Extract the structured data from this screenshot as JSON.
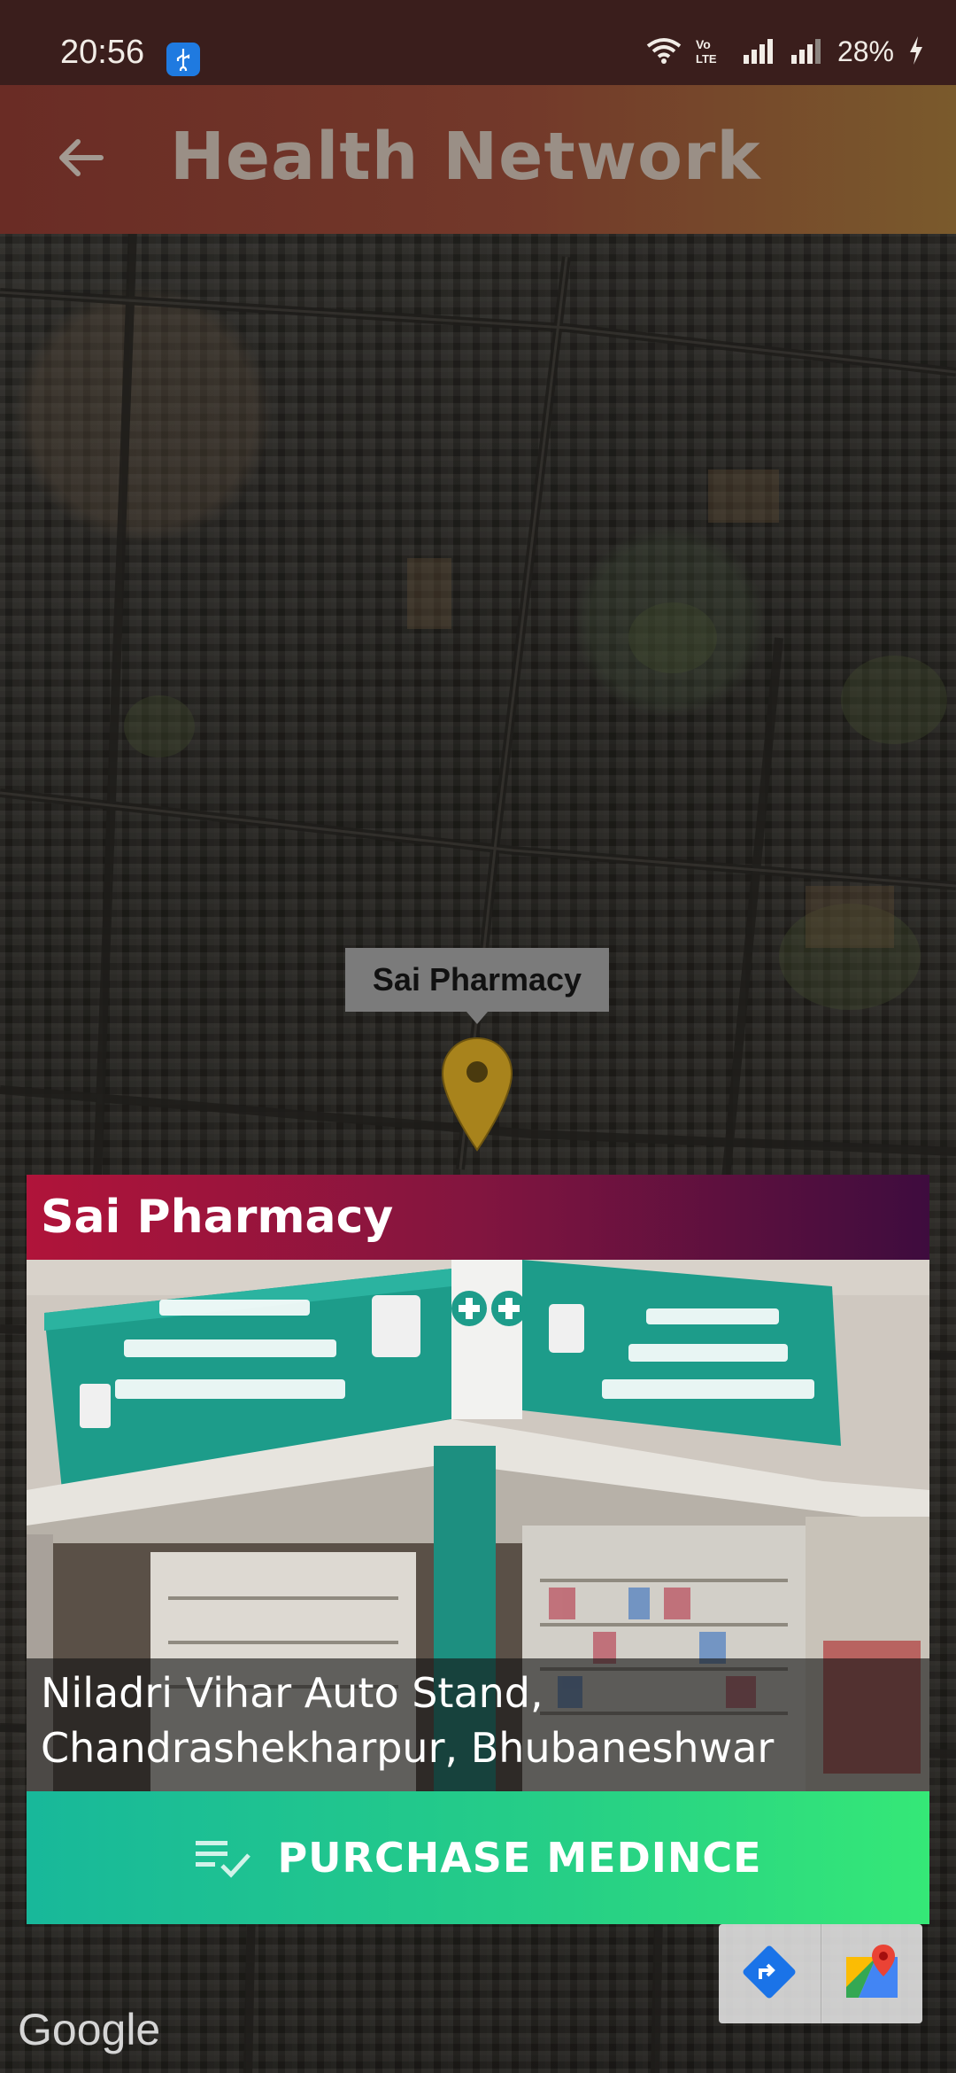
{
  "status_bar": {
    "time": "20:56",
    "network_label": "Vo LTE",
    "battery": "28%"
  },
  "app_bar": {
    "title": "Health Network",
    "back_icon": "arrow-left-icon"
  },
  "map": {
    "marker_label": "Sai Pharmacy",
    "pin_color": "#b08a1e",
    "attribution": "Google"
  },
  "card": {
    "title": "Sai Pharmacy",
    "address_line1": "Niladri Vihar Auto Stand,",
    "address_line2": "Chandrashekharpur, Bhubaneshwar",
    "purchase_label": "PURCHASE MEDINCE",
    "purchase_icon": "playlist-check-icon"
  },
  "map_toolbar": {
    "directions_icon": "directions-icon",
    "open_maps_icon": "google-maps-icon"
  },
  "colors": {
    "header_gradient": [
      "#b0143a",
      "#3e0c3e"
    ],
    "button_gradient": [
      "#18b89a",
      "#35e877"
    ],
    "app_bar_gradient": [
      "#6a2c25",
      "#7a5a2c"
    ]
  }
}
